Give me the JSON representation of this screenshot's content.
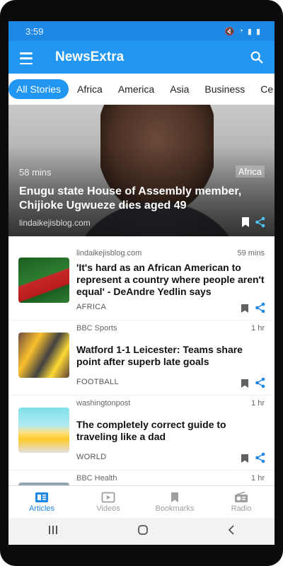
{
  "status": {
    "time": "3:59"
  },
  "appbar": {
    "title": "NewsExtra"
  },
  "categories": [
    "All Stories",
    "Africa",
    "America",
    "Asia",
    "Business",
    "Ce"
  ],
  "hero": {
    "time": "58 mins",
    "category": "Africa",
    "title": "Enugu state House of Assembly member, Chijioke Ugwueze dies aged 49",
    "source": "lindaikejisblog.com"
  },
  "articles": [
    {
      "source": "lindaikejisblog.com",
      "age": "59 mins",
      "title": "'It's hard as an African American to represent a country where people aren't equal' - DeAndre Yedlin says",
      "category": "AFRICA"
    },
    {
      "source": "BBC Sports",
      "age": "1 hr",
      "title": "Watford 1-1 Leicester: Teams share point after superb late goals",
      "category": "FOOTBALL"
    },
    {
      "source": "washingtonpost",
      "age": "1 hr",
      "title": "The completely correct guide to traveling like a dad",
      "category": "WORLD"
    },
    {
      "source": "BBC Health",
      "age": "1 hr",
      "title": "",
      "category": ""
    }
  ],
  "bottomnav": {
    "articles": "Articles",
    "videos": "Videos",
    "bookmarks": "Bookmarks",
    "radio": "Radio"
  },
  "colors": {
    "primary": "#2196f3",
    "statusbar": "#1e88e5",
    "accent_text": "#1e88e5"
  },
  "icons": [
    "menu-icon",
    "search-icon",
    "bookmark-icon",
    "share-icon",
    "articles-icon",
    "videos-icon",
    "bookmarks-icon",
    "radio-icon",
    "back-icon",
    "home-icon",
    "recents-icon"
  ]
}
